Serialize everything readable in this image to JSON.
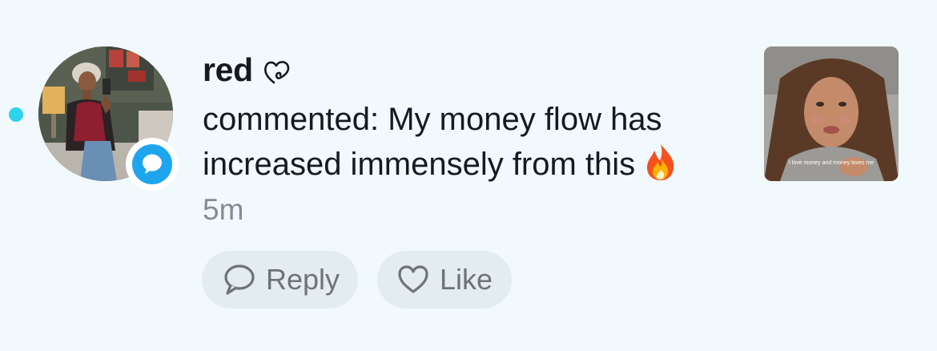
{
  "notification": {
    "username": "red",
    "action_text": "commented: My money flow has increased immensely from this",
    "timestamp": "5m",
    "unread": true,
    "badge_icon": "comment-bubble-icon",
    "badge_color": "#1ea5ee",
    "unread_dot_color": "#2fd3ec",
    "emoji": "fire"
  },
  "actions": {
    "reply_label": "Reply",
    "like_label": "Like"
  },
  "thumbnail": {
    "caption": "I love money and money loves me"
  }
}
